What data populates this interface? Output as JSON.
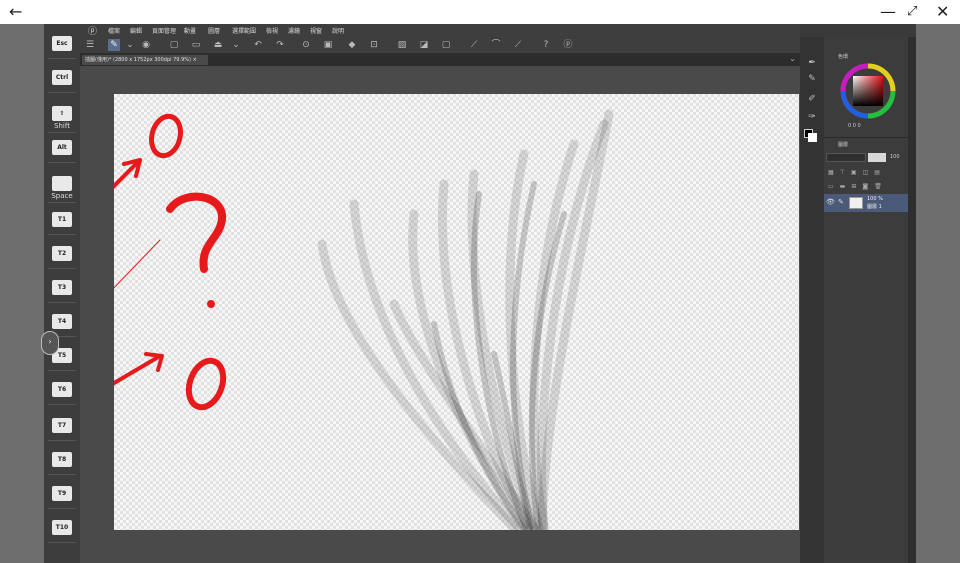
{
  "window": {
    "back_icon": "arrow-left-icon",
    "min_icon": "minimize-icon",
    "restore_icon": "restore-icon",
    "close_icon": "close-icon"
  },
  "keys": [
    {
      "label": "Esc"
    },
    {
      "label": "Ctrl"
    },
    {
      "label": "⇧",
      "sub": "Shift"
    },
    {
      "label": "Alt"
    },
    {
      "label": "",
      "sub": "Space"
    },
    {
      "label": "T1"
    },
    {
      "label": "T2"
    },
    {
      "label": "T3"
    },
    {
      "label": "T4"
    },
    {
      "label": "T5"
    },
    {
      "label": "T6"
    },
    {
      "label": "T7"
    },
    {
      "label": "T8"
    },
    {
      "label": "T9"
    },
    {
      "label": "T10"
    }
  ],
  "menu": [
    "檔案",
    "編輯",
    "頁面管理",
    "動畫",
    "圖層",
    "選擇範圍",
    "檢視",
    "濾鏡",
    "視窗",
    "說明"
  ],
  "tab": {
    "title": "插圖(僅用)* (2800 x 1752px 300dpi 79.9%)",
    "close": "×"
  },
  "panels": {
    "color_title": "色環",
    "layer_title": "圖層",
    "opacity": "100",
    "color_values": "0  0  0",
    "layer_percent": "100 %",
    "layer_name": "圖層 1"
  },
  "colors": {
    "annotation": "#e8191b"
  }
}
